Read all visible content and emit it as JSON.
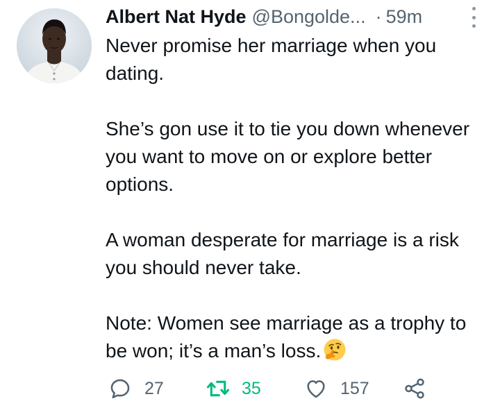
{
  "tweet": {
    "author_name": "Albert Nat Hyde",
    "handle": "@Bongolde...",
    "separator": "·",
    "time": "59m",
    "paragraphs": [
      "Never promise her marriage when you dating.",
      "She’s gon use it to tie you down whenever you want to move on or explore better options.",
      "A woman desperate for marriage is a risk you should never take.",
      "Note: Women see marriage as a trophy to be won; it’s a man’s loss."
    ],
    "trailing_emoji": "thinking-face"
  },
  "actions": {
    "reply_count": "27",
    "retweet_count": "35",
    "like_count": "157",
    "retweeted": true
  },
  "colors": {
    "text_primary": "#0f1419",
    "text_secondary": "#536471",
    "retweet_active": "#00ba7c",
    "emoji_yellow": "#ffcc4d"
  },
  "icons": [
    "avatar",
    "more-options-icon",
    "reply-icon",
    "retweet-icon",
    "like-icon",
    "share-icon",
    "thinking-face-emoji"
  ]
}
